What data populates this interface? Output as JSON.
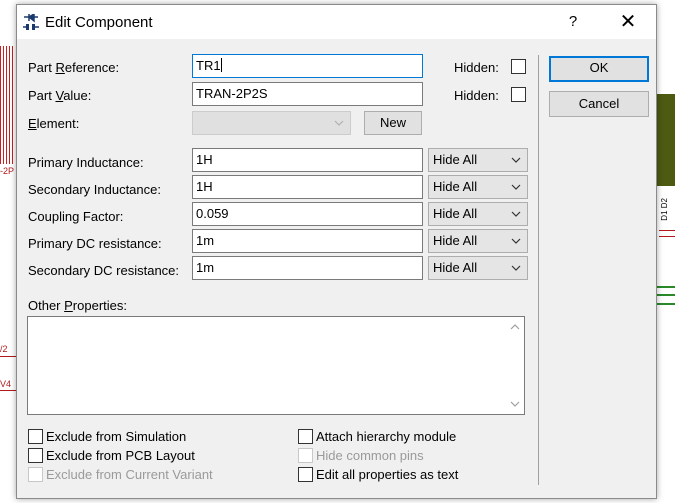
{
  "background": {
    "left_labels": [
      "-2P",
      "/2",
      "V4"
    ],
    "right_labels": [
      "D1",
      "D2"
    ]
  },
  "titlebar": {
    "title": "Edit Component",
    "help_label": "?",
    "close_label": "✕"
  },
  "fields": {
    "part_reference": {
      "label_pre": "Part ",
      "label_ul": "R",
      "label_post": "eference:",
      "value": "TR1"
    },
    "part_value": {
      "label_pre": "Part ",
      "label_ul": "V",
      "label_post": "alue:",
      "value": "TRAN-2P2S"
    },
    "element": {
      "label_pre": "",
      "label_ul": "E",
      "label_post": "lement:",
      "value": ""
    },
    "hidden_label": "Hidden:",
    "new_button": "New"
  },
  "properties": [
    {
      "label": "Primary Inductance:",
      "value": "1H",
      "visibility": "Hide All"
    },
    {
      "label": "Secondary Inductance:",
      "value": "1H",
      "visibility": "Hide All"
    },
    {
      "label": "Coupling Factor:",
      "value": "0.059",
      "visibility": "Hide All"
    },
    {
      "label": "Primary DC resistance:",
      "value": "1m",
      "visibility": "Hide All"
    },
    {
      "label": "Secondary DC resistance:",
      "value": "1m",
      "visibility": "Hide All"
    }
  ],
  "other_properties": {
    "label_pre": "Other ",
    "label_ul": "P",
    "label_post": "roperties:",
    "text": ""
  },
  "options": {
    "exclude_simulation": "Exclude from Simulation",
    "exclude_pcb": "Exclude from PCB Layout",
    "exclude_variant": "Exclude from Current Variant",
    "attach_hierarchy": "Attach hierarchy module",
    "hide_pins": "Hide common pins",
    "edit_all_text": "Edit all properties as text"
  },
  "buttons": {
    "ok": "OK",
    "cancel": "Cancel"
  },
  "colors": {
    "accent": "#0078d7",
    "dialog_bg": "#f0f0f0",
    "schematic_red": "#b01a1a",
    "board_green": "#4d5b12"
  }
}
